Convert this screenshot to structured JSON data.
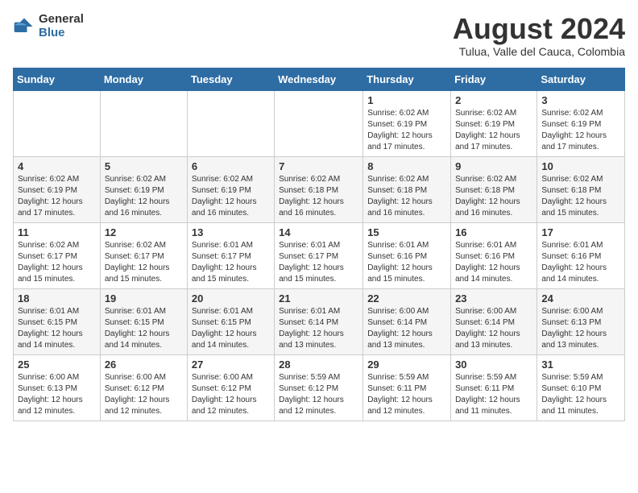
{
  "header": {
    "logo_general": "General",
    "logo_blue": "Blue",
    "month_year": "August 2024",
    "location": "Tulua, Valle del Cauca, Colombia"
  },
  "weekdays": [
    "Sunday",
    "Monday",
    "Tuesday",
    "Wednesday",
    "Thursday",
    "Friday",
    "Saturday"
  ],
  "weeks": [
    [
      {
        "day": "",
        "detail": ""
      },
      {
        "day": "",
        "detail": ""
      },
      {
        "day": "",
        "detail": ""
      },
      {
        "day": "",
        "detail": ""
      },
      {
        "day": "1",
        "detail": "Sunrise: 6:02 AM\nSunset: 6:19 PM\nDaylight: 12 hours\nand 17 minutes."
      },
      {
        "day": "2",
        "detail": "Sunrise: 6:02 AM\nSunset: 6:19 PM\nDaylight: 12 hours\nand 17 minutes."
      },
      {
        "day": "3",
        "detail": "Sunrise: 6:02 AM\nSunset: 6:19 PM\nDaylight: 12 hours\nand 17 minutes."
      }
    ],
    [
      {
        "day": "4",
        "detail": "Sunrise: 6:02 AM\nSunset: 6:19 PM\nDaylight: 12 hours\nand 17 minutes."
      },
      {
        "day": "5",
        "detail": "Sunrise: 6:02 AM\nSunset: 6:19 PM\nDaylight: 12 hours\nand 16 minutes."
      },
      {
        "day": "6",
        "detail": "Sunrise: 6:02 AM\nSunset: 6:19 PM\nDaylight: 12 hours\nand 16 minutes."
      },
      {
        "day": "7",
        "detail": "Sunrise: 6:02 AM\nSunset: 6:18 PM\nDaylight: 12 hours\nand 16 minutes."
      },
      {
        "day": "8",
        "detail": "Sunrise: 6:02 AM\nSunset: 6:18 PM\nDaylight: 12 hours\nand 16 minutes."
      },
      {
        "day": "9",
        "detail": "Sunrise: 6:02 AM\nSunset: 6:18 PM\nDaylight: 12 hours\nand 16 minutes."
      },
      {
        "day": "10",
        "detail": "Sunrise: 6:02 AM\nSunset: 6:18 PM\nDaylight: 12 hours\nand 15 minutes."
      }
    ],
    [
      {
        "day": "11",
        "detail": "Sunrise: 6:02 AM\nSunset: 6:17 PM\nDaylight: 12 hours\nand 15 minutes."
      },
      {
        "day": "12",
        "detail": "Sunrise: 6:02 AM\nSunset: 6:17 PM\nDaylight: 12 hours\nand 15 minutes."
      },
      {
        "day": "13",
        "detail": "Sunrise: 6:01 AM\nSunset: 6:17 PM\nDaylight: 12 hours\nand 15 minutes."
      },
      {
        "day": "14",
        "detail": "Sunrise: 6:01 AM\nSunset: 6:17 PM\nDaylight: 12 hours\nand 15 minutes."
      },
      {
        "day": "15",
        "detail": "Sunrise: 6:01 AM\nSunset: 6:16 PM\nDaylight: 12 hours\nand 15 minutes."
      },
      {
        "day": "16",
        "detail": "Sunrise: 6:01 AM\nSunset: 6:16 PM\nDaylight: 12 hours\nand 14 minutes."
      },
      {
        "day": "17",
        "detail": "Sunrise: 6:01 AM\nSunset: 6:16 PM\nDaylight: 12 hours\nand 14 minutes."
      }
    ],
    [
      {
        "day": "18",
        "detail": "Sunrise: 6:01 AM\nSunset: 6:15 PM\nDaylight: 12 hours\nand 14 minutes."
      },
      {
        "day": "19",
        "detail": "Sunrise: 6:01 AM\nSunset: 6:15 PM\nDaylight: 12 hours\nand 14 minutes."
      },
      {
        "day": "20",
        "detail": "Sunrise: 6:01 AM\nSunset: 6:15 PM\nDaylight: 12 hours\nand 14 minutes."
      },
      {
        "day": "21",
        "detail": "Sunrise: 6:01 AM\nSunset: 6:14 PM\nDaylight: 12 hours\nand 13 minutes."
      },
      {
        "day": "22",
        "detail": "Sunrise: 6:00 AM\nSunset: 6:14 PM\nDaylight: 12 hours\nand 13 minutes."
      },
      {
        "day": "23",
        "detail": "Sunrise: 6:00 AM\nSunset: 6:14 PM\nDaylight: 12 hours\nand 13 minutes."
      },
      {
        "day": "24",
        "detail": "Sunrise: 6:00 AM\nSunset: 6:13 PM\nDaylight: 12 hours\nand 13 minutes."
      }
    ],
    [
      {
        "day": "25",
        "detail": "Sunrise: 6:00 AM\nSunset: 6:13 PM\nDaylight: 12 hours\nand 12 minutes."
      },
      {
        "day": "26",
        "detail": "Sunrise: 6:00 AM\nSunset: 6:12 PM\nDaylight: 12 hours\nand 12 minutes."
      },
      {
        "day": "27",
        "detail": "Sunrise: 6:00 AM\nSunset: 6:12 PM\nDaylight: 12 hours\nand 12 minutes."
      },
      {
        "day": "28",
        "detail": "Sunrise: 5:59 AM\nSunset: 6:12 PM\nDaylight: 12 hours\nand 12 minutes."
      },
      {
        "day": "29",
        "detail": "Sunrise: 5:59 AM\nSunset: 6:11 PM\nDaylight: 12 hours\nand 12 minutes."
      },
      {
        "day": "30",
        "detail": "Sunrise: 5:59 AM\nSunset: 6:11 PM\nDaylight: 12 hours\nand 11 minutes."
      },
      {
        "day": "31",
        "detail": "Sunrise: 5:59 AM\nSunset: 6:10 PM\nDaylight: 12 hours\nand 11 minutes."
      }
    ]
  ]
}
